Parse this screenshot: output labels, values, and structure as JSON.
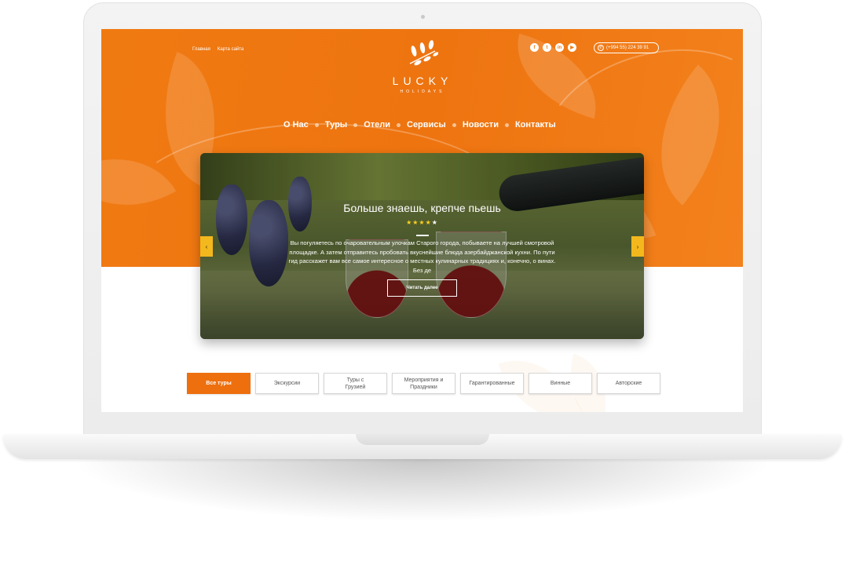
{
  "colors": {
    "accent": "#ee7410",
    "button_active": "#ee6f0e",
    "arrow": "#f3b81d",
    "star": "#ffd21f"
  },
  "toplinks": [
    "Главная",
    "Карта сайта"
  ],
  "logo": {
    "name": "LUCKY",
    "sub": "HOLIDAYS"
  },
  "social": [
    {
      "icon": "facebook-icon",
      "glyph": "f"
    },
    {
      "icon": "twitter-icon",
      "glyph": "t"
    },
    {
      "icon": "linkedin-icon",
      "glyph": "in"
    },
    {
      "icon": "youtube-icon",
      "glyph": "▶"
    }
  ],
  "phone": {
    "icon": "phone-icon",
    "number": "(+994 55) 224 39 91"
  },
  "nav": [
    "О Нас",
    "Туры",
    "Отели",
    "Сервисы",
    "Новости",
    "Контакты"
  ],
  "slide": {
    "title": "Больше знаешь, крепче пьешь",
    "rating": 4,
    "rating_max": 5,
    "text": "Вы погуляетесь по очаровательным улочкам Старого города, побываете на лучшей смотровой площадке. А затем отправитесь пробовать вкуснейшие блюда азербайджанской кухни. По пути гид расскажет вам все самое интересное о местных кулинарных традициях и, конечно, о винах. Без де",
    "button": "Читать далее",
    "prev": "‹",
    "next": "›"
  },
  "filters": [
    {
      "label": "Все туры",
      "active": true
    },
    {
      "label": "Экскурсии",
      "active": false
    },
    {
      "label": "Туры с Грузией",
      "active": false
    },
    {
      "label": "Мероприятия и Праздники",
      "active": false
    },
    {
      "label": "Гарантированные",
      "active": false
    },
    {
      "label": "Винные",
      "active": false
    },
    {
      "label": "Авторские",
      "active": false
    }
  ]
}
